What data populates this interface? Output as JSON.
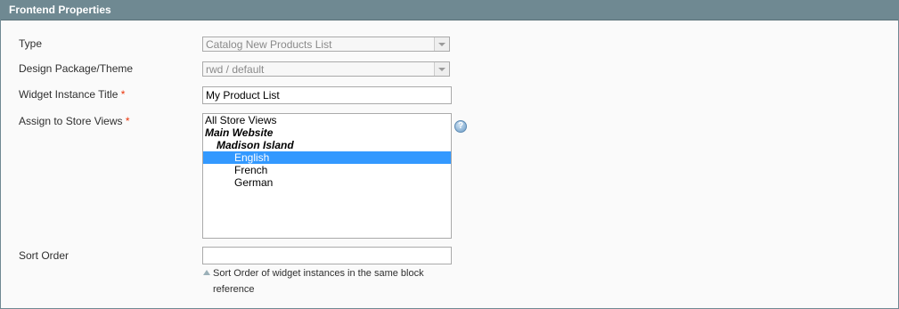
{
  "panel": {
    "title": "Frontend Properties"
  },
  "fields": {
    "type": {
      "label": "Type",
      "value": "Catalog New Products List"
    },
    "theme": {
      "label": "Design Package/Theme",
      "value": "rwd / default"
    },
    "title": {
      "label": "Widget Instance Title",
      "required_mark": "*",
      "value": "My Product List"
    },
    "store_views": {
      "label": "Assign to Store Views",
      "required_mark": "*",
      "options": [
        "All Store Views",
        "Main Website",
        "Madison Island",
        "English",
        "French",
        "German"
      ],
      "selected": "English"
    },
    "sort_order": {
      "label": "Sort Order",
      "value": "",
      "note": "Sort Order of widget instances in the same block reference"
    }
  },
  "help_icon": {
    "name": "help-icon",
    "glyph": "?"
  },
  "colors": {
    "header_bg": "#6f8992",
    "selected_bg": "#3399ff",
    "required": "#eb340a"
  }
}
